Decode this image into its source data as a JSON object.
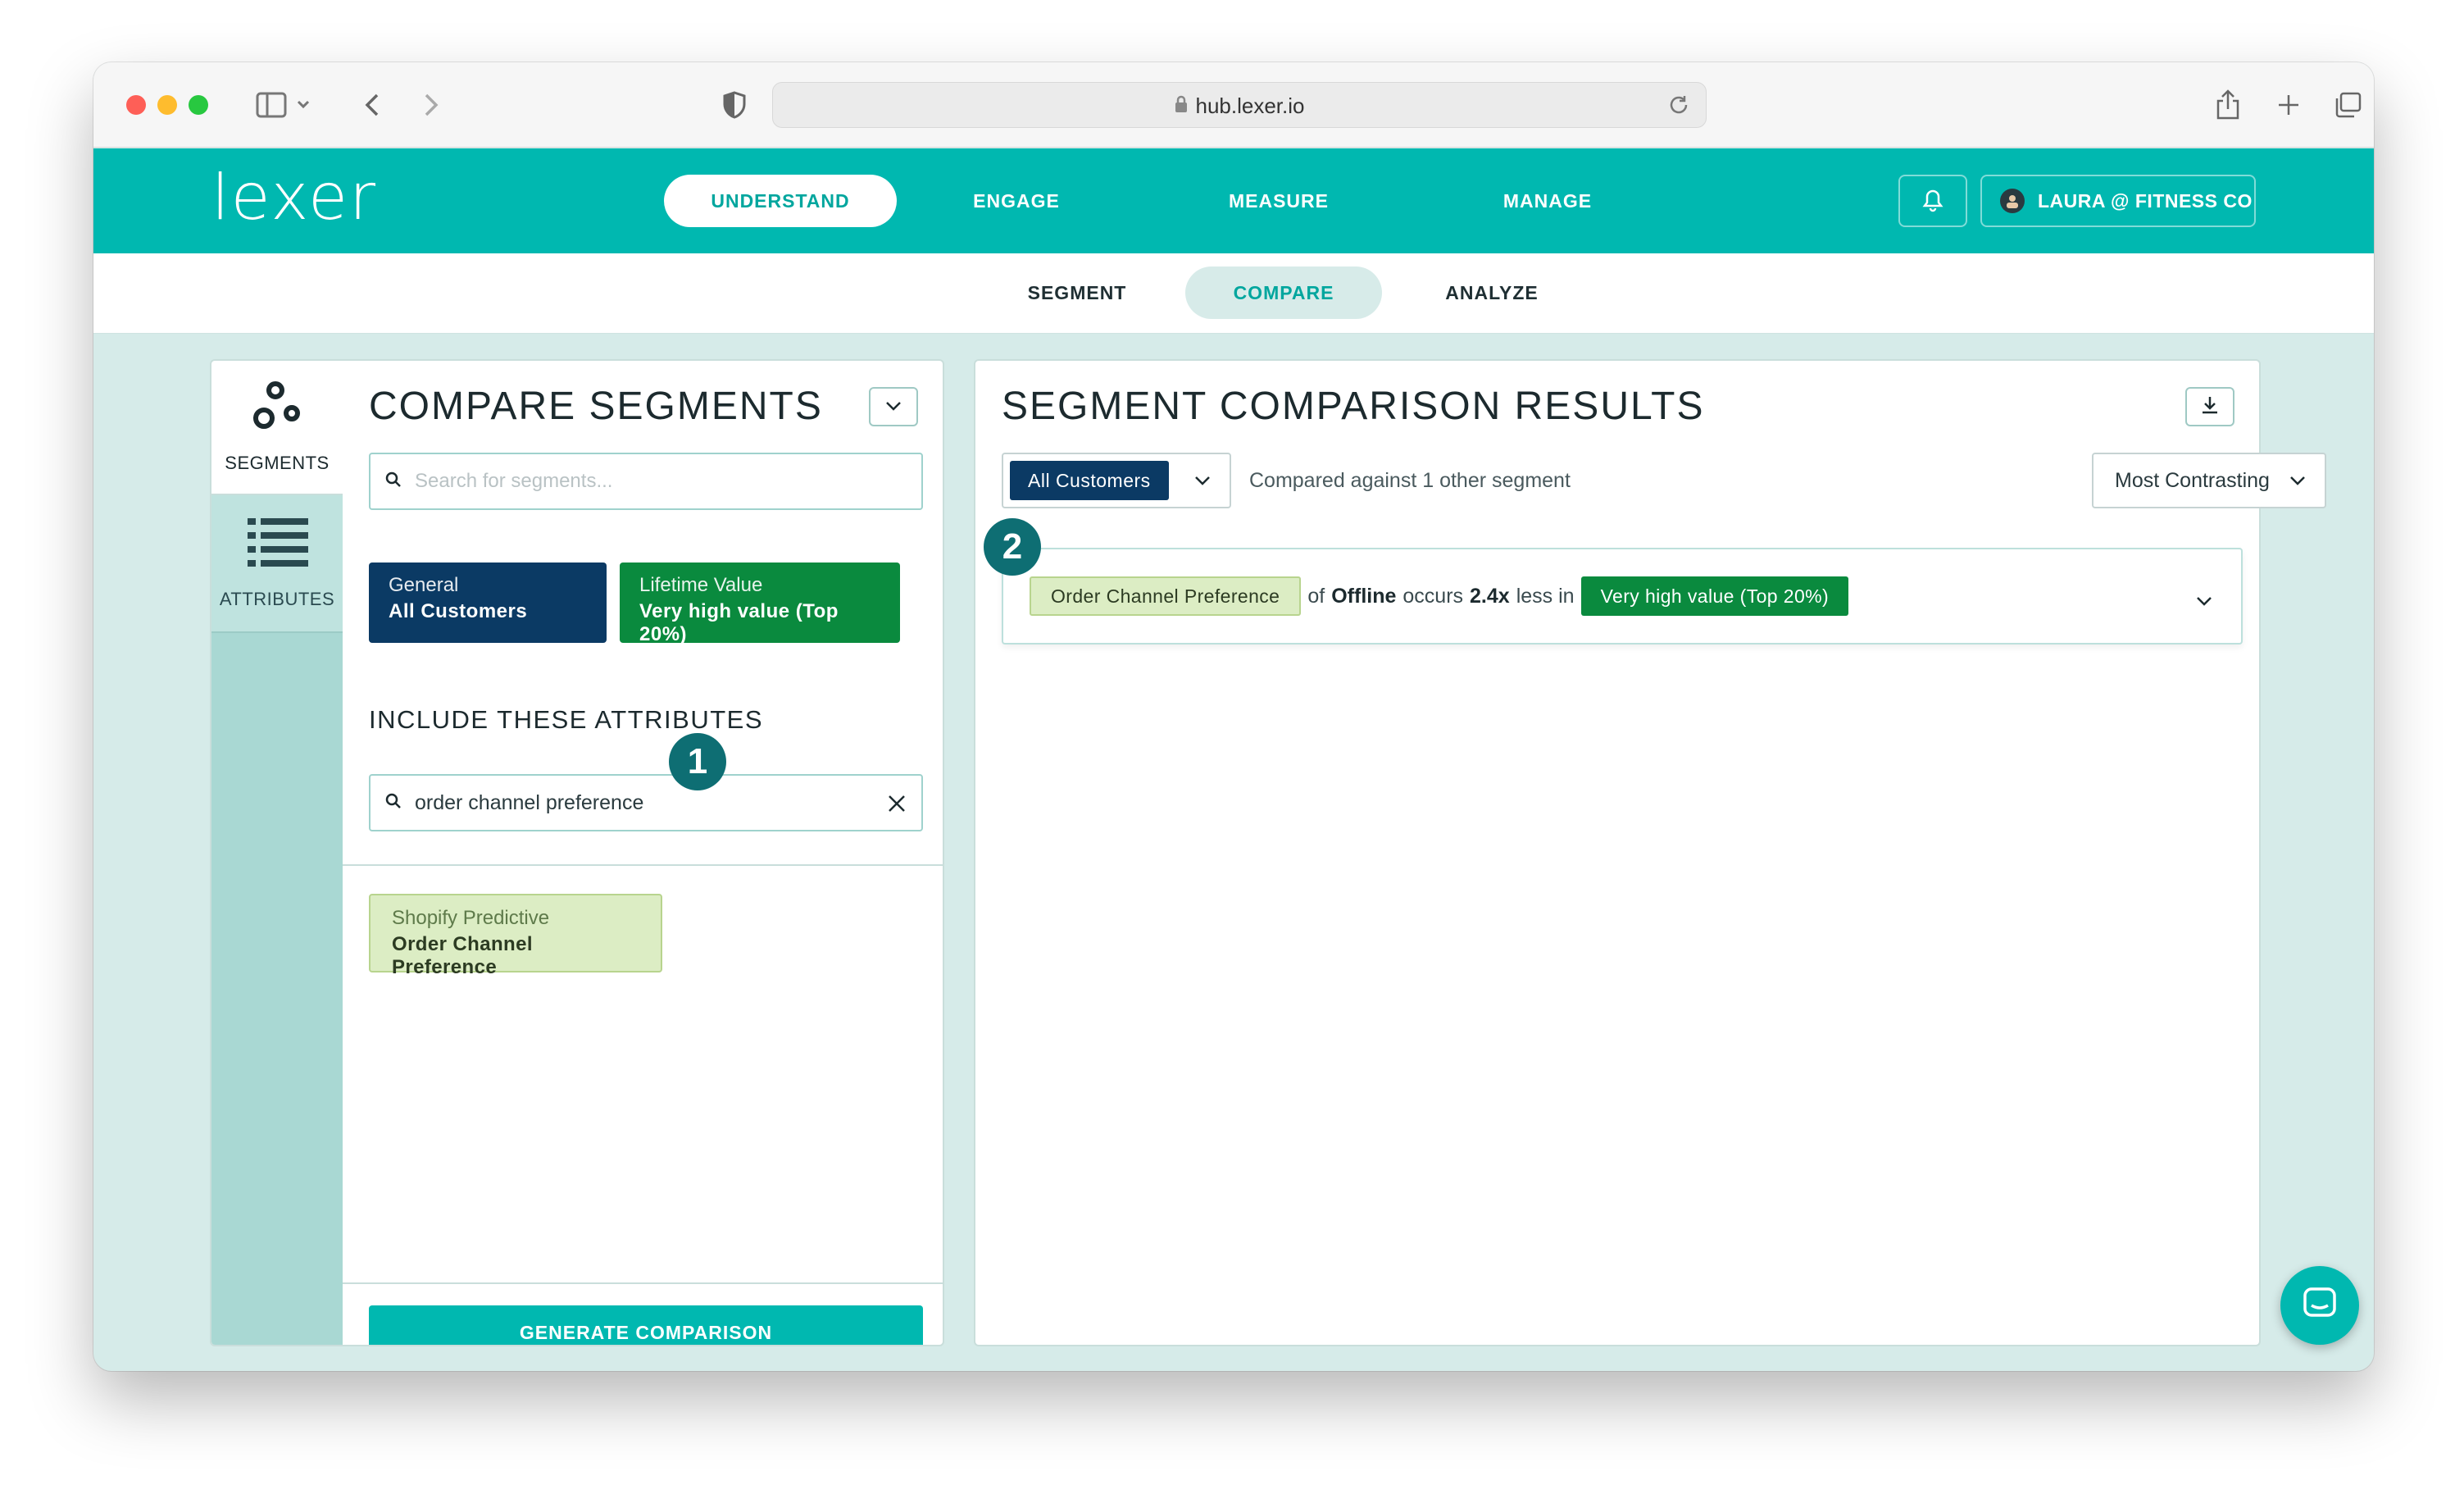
{
  "browser": {
    "url": "hub.lexer.io"
  },
  "app": {
    "logo_text": "lexer",
    "nav": [
      {
        "label": "UNDERSTAND",
        "active": true
      },
      {
        "label": "ENGAGE",
        "active": false
      },
      {
        "label": "MEASURE",
        "active": false
      },
      {
        "label": "MANAGE",
        "active": false
      }
    ],
    "user_label": "LAURA @ FITNESS CO",
    "subnav": [
      {
        "label": "SEGMENT",
        "active": false
      },
      {
        "label": "COMPARE",
        "active": true
      },
      {
        "label": "ANALYZE",
        "active": false
      }
    ]
  },
  "sidebar": {
    "items": [
      {
        "label": "SEGMENTS",
        "icon": "segments-icon"
      },
      {
        "label": "ATTRIBUTES",
        "icon": "list-icon"
      }
    ]
  },
  "compare": {
    "title": "COMPARE SEGMENTS",
    "search_placeholder": "Search for segments...",
    "segments": [
      {
        "category": "General",
        "name": "All Customers",
        "color": "#0b3a64"
      },
      {
        "category": "Lifetime Value",
        "name": "Very high value (Top 20%)",
        "color": "#0a8a3e"
      }
    ],
    "attributes_heading": "INCLUDE THESE ATTRIBUTES",
    "attribute_search_value": "order channel preference",
    "step_badge": "1",
    "attribute_results": [
      {
        "source": "Shopify Predictive",
        "name": "Order Channel Preference"
      }
    ],
    "generate_label": "GENERATE COMPARISON"
  },
  "results": {
    "title": "SEGMENT COMPARISON RESULTS",
    "base_segment": "All Customers",
    "compared_text": "Compared against 1 other segment",
    "sort_value": "Most Contrasting",
    "step_badge": "2",
    "rows": [
      {
        "attribute": "Order Channel Preference",
        "text_of": "of",
        "value": "Offline",
        "text_occurs": "occurs",
        "factor": "2.4x",
        "text_less": "less in",
        "segment": "Very high value (Top 20%)"
      }
    ]
  },
  "colors": {
    "brand": "#00b8b0",
    "navy": "#0b3a64",
    "green": "#0a8a3e",
    "badge": "#0e6e73"
  }
}
